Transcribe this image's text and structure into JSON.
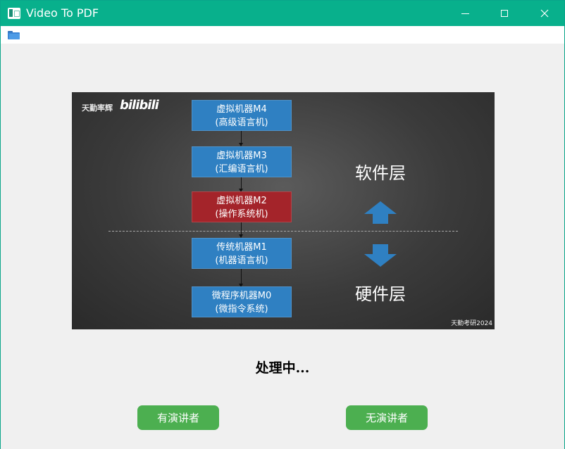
{
  "window": {
    "title": "Video To PDF"
  },
  "menubar": {
    "open_icon": "folder-icon"
  },
  "frame": {
    "watermark": "天勤率辉",
    "brand": "bilibili",
    "boxes": [
      {
        "line1": "虚拟机器M4",
        "line2": "(高级语言机)",
        "color": "#2f80c2"
      },
      {
        "line1": "虚拟机器M3",
        "line2": "(汇编语言机)",
        "color": "#2f80c2"
      },
      {
        "line1": "虚拟机器M2",
        "line2": "(操作系统机)",
        "color": "#a4242a"
      },
      {
        "line1": "传统机器M1",
        "line2": "(机器语言机)",
        "color": "#2f80c2"
      },
      {
        "line1": "微程序机器M0",
        "line2": "(微指令系统)",
        "color": "#2f80c2"
      }
    ],
    "software_label": "软件层",
    "hardware_label": "硬件层",
    "credit": "天勤考研2024"
  },
  "status": {
    "text": "处理中..."
  },
  "buttons": {
    "with_speaker": "有演讲者",
    "without_speaker": "无演讲者",
    "color": "#4caf50"
  }
}
